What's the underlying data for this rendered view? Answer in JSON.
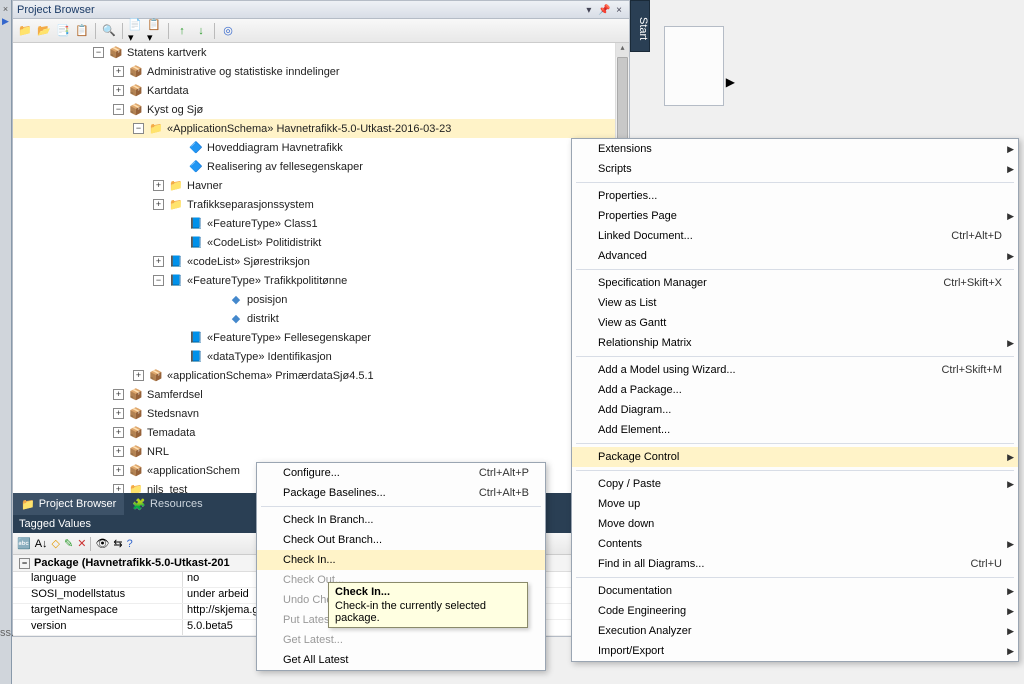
{
  "panel": {
    "title": "Project Browser"
  },
  "toolbar_icons": [
    "📁",
    "📂",
    "📑",
    "📋",
    "🔍",
    "📄",
    "📋",
    "↑",
    "↓",
    "◎"
  ],
  "tree": [
    {
      "indent": 80,
      "exp": "-",
      "ico": "model",
      "label": "Statens kartverk",
      "sel": false
    },
    {
      "indent": 100,
      "exp": "+",
      "ico": "model",
      "label": "Administrative og statistiske inndelinger",
      "sel": false
    },
    {
      "indent": 100,
      "exp": "+",
      "ico": "model",
      "label": "Kartdata",
      "sel": false
    },
    {
      "indent": 100,
      "exp": "-",
      "ico": "model",
      "label": "Kyst og Sjø",
      "sel": false
    },
    {
      "indent": 120,
      "exp": "-",
      "ico": "folder",
      "label": "«ApplicationSchema» Havnetrafikk-5.0-Utkast-2016-03-23",
      "sel": true
    },
    {
      "indent": 160,
      "exp": "",
      "ico": "diag",
      "label": "Hoveddiagram Havnetrafikk",
      "sel": false
    },
    {
      "indent": 160,
      "exp": "",
      "ico": "diag",
      "label": "Realisering av fellesegenskaper",
      "sel": false
    },
    {
      "indent": 140,
      "exp": "+",
      "ico": "folder",
      "label": "Havner",
      "sel": false
    },
    {
      "indent": 140,
      "exp": "+",
      "ico": "folder",
      "label": "Trafikkseparasjonssystem",
      "sel": false
    },
    {
      "indent": 160,
      "exp": "",
      "ico": "class",
      "label": "«FeatureType» Class1",
      "sel": false
    },
    {
      "indent": 160,
      "exp": "",
      "ico": "class",
      "label": "«CodeList» Politidistrikt",
      "sel": false
    },
    {
      "indent": 140,
      "exp": "+",
      "ico": "class",
      "label": "«codeList» Sjørestriksjon",
      "sel": false
    },
    {
      "indent": 140,
      "exp": "-",
      "ico": "class",
      "label": "«FeatureType» Trafikkpolititønne",
      "sel": false
    },
    {
      "indent": 200,
      "exp": "",
      "ico": "attr",
      "label": "posisjon",
      "sel": false
    },
    {
      "indent": 200,
      "exp": "",
      "ico": "attr",
      "label": "distrikt",
      "sel": false
    },
    {
      "indent": 160,
      "exp": "",
      "ico": "class",
      "label": "«FeatureType» Fellesegenskaper",
      "sel": false
    },
    {
      "indent": 160,
      "exp": "",
      "ico": "class",
      "label": "«dataType» Identifikasjon",
      "sel": false
    },
    {
      "indent": 120,
      "exp": "+",
      "ico": "pkg",
      "label": "«applicationSchema» PrimærdataSjø4.5.1",
      "sel": false
    },
    {
      "indent": 100,
      "exp": "+",
      "ico": "model",
      "label": "Samferdsel",
      "sel": false
    },
    {
      "indent": 100,
      "exp": "+",
      "ico": "model",
      "label": "Stedsnavn",
      "sel": false
    },
    {
      "indent": 100,
      "exp": "+",
      "ico": "model",
      "label": "Temadata",
      "sel": false
    },
    {
      "indent": 100,
      "exp": "+",
      "ico": "model",
      "label": "NRL",
      "sel": false
    },
    {
      "indent": 100,
      "exp": "+",
      "ico": "pkg",
      "label": "«applicationSchem",
      "sel": false
    },
    {
      "indent": 100,
      "exp": "+",
      "ico": "folder",
      "label": "nils_test",
      "sel": false
    }
  ],
  "tabs": [
    {
      "label": "Project Browser",
      "active": true
    },
    {
      "label": "Resources",
      "active": false
    }
  ],
  "tagged": {
    "title": "Tagged Values",
    "section": "Package (Havnetrafikk-5.0-Utkast-201",
    "rows": [
      {
        "k": "language",
        "v": "no"
      },
      {
        "k": "SOSI_modellstatus",
        "v": "under arbeid"
      },
      {
        "k": "targetNamespace",
        "v": "http://skjema.ge"
      },
      {
        "k": "version",
        "v": "5.0.beta5"
      }
    ]
  },
  "sidetab": "Start",
  "ss": "ss.",
  "context_main": [
    {
      "label": "Extensions",
      "sub": true
    },
    {
      "label": "Scripts",
      "sub": true
    },
    {
      "sep": true
    },
    {
      "label": "Properties...",
      "sub": false
    },
    {
      "label": "Properties Page",
      "sub": true
    },
    {
      "label": "Linked Document...",
      "sc": "Ctrl+Alt+D"
    },
    {
      "label": "Advanced",
      "sub": true
    },
    {
      "sep": true
    },
    {
      "label": "Specification Manager",
      "sc": "Ctrl+Skift+X"
    },
    {
      "label": "View as List",
      "sub": false
    },
    {
      "label": "View as Gantt",
      "sub": false
    },
    {
      "label": "Relationship Matrix",
      "sub": true
    },
    {
      "sep": true
    },
    {
      "label": "Add a Model using Wizard...",
      "sc": "Ctrl+Skift+M"
    },
    {
      "label": "Add a Package...",
      "sub": false
    },
    {
      "label": "Add Diagram...",
      "sub": false
    },
    {
      "label": "Add Element...",
      "sub": false
    },
    {
      "sep": true
    },
    {
      "label": "Package Control",
      "sub": true,
      "sel": true
    },
    {
      "sep": true
    },
    {
      "label": "Copy / Paste",
      "sub": true
    },
    {
      "label": "Move up",
      "sub": false
    },
    {
      "label": "Move down",
      "sub": false
    },
    {
      "label": "Contents",
      "sub": true
    },
    {
      "label": "Find in all Diagrams...",
      "sc": "Ctrl+U"
    },
    {
      "sep": true
    },
    {
      "label": "Documentation",
      "sub": true
    },
    {
      "label": "Code Engineering",
      "sub": true
    },
    {
      "label": "Execution Analyzer",
      "sub": true
    },
    {
      "label": "Import/Export",
      "sub": true
    }
  ],
  "context_sub": [
    {
      "label": "Configure...",
      "sc": "Ctrl+Alt+P"
    },
    {
      "label": "Package Baselines...",
      "sc": "Ctrl+Alt+B"
    },
    {
      "sep": true
    },
    {
      "label": "Check In Branch...",
      "sub": false
    },
    {
      "label": "Check Out Branch...",
      "sub": false
    },
    {
      "label": "Check In...",
      "sel": true
    },
    {
      "label": "Check Out...",
      "disabled": true
    },
    {
      "label": "Undo Check Out...",
      "disabled": true
    },
    {
      "label": "Put Latest...",
      "disabled": true
    },
    {
      "label": "Get Latest...",
      "disabled": true
    },
    {
      "label": "Get All Latest",
      "sub": false
    }
  ],
  "tooltip": {
    "title": "Check In...",
    "body": "Check-in the currently selected package."
  }
}
